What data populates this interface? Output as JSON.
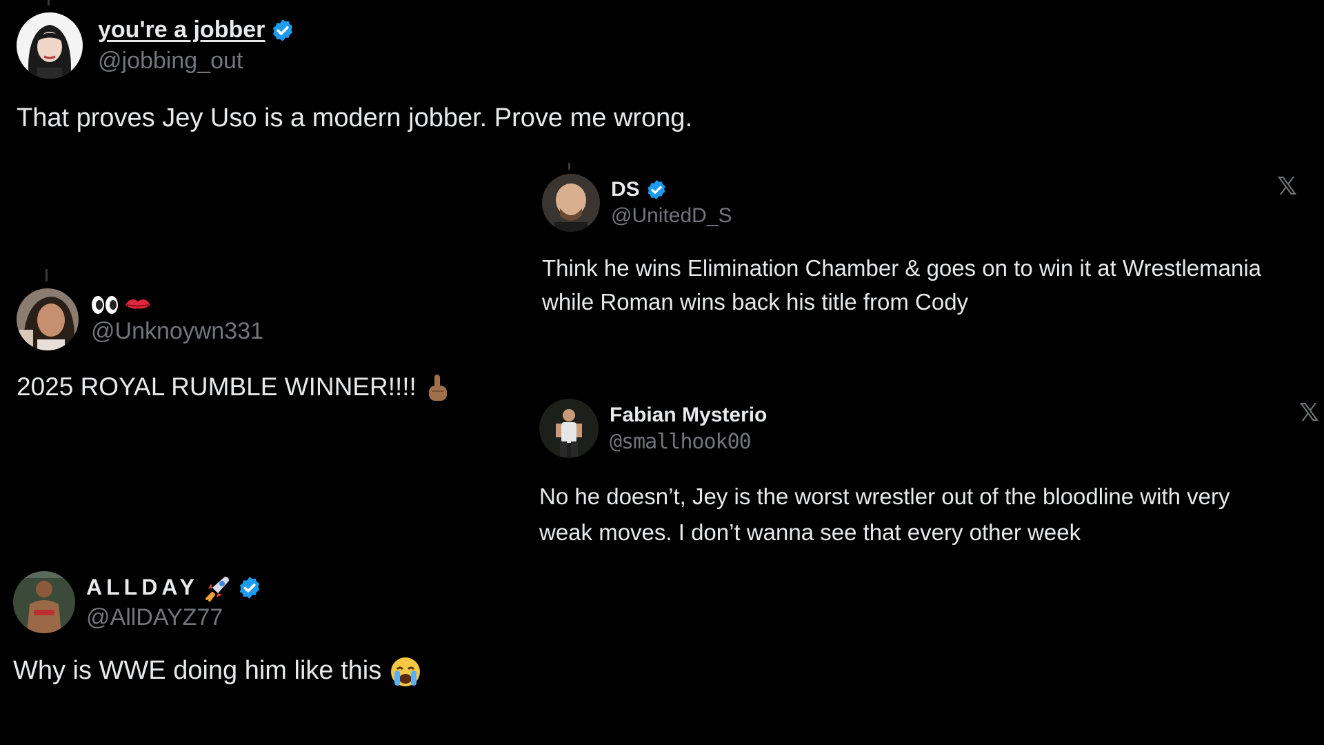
{
  "tweets": [
    {
      "display_name": "you're a jobber",
      "handle": "@jobbing_out",
      "verified": true,
      "text": "That proves Jey Uso is a modern jobber. Prove me wrong."
    },
    {
      "display_name": "DS",
      "handle": "@UnitedD_S",
      "verified": true,
      "text": "Think he wins Elimination Chamber & goes on to win it at Wrestlemania\nwhile Roman wins back his title from Cody"
    },
    {
      "display_name_emojis": [
        "eyes-emoji",
        "kiss-mark-emoji"
      ],
      "handle": "@Unknoywn331",
      "verified": false,
      "text": "2025 ROYAL RUMBLE WINNER!!!!",
      "text_emoji": "index-pointing-up-emoji"
    },
    {
      "display_name": "Fabian Mysterio",
      "handle": "@smallhook00",
      "verified": false,
      "text": "No he doesn’t, Jey is the worst wrestler out of the bloodline with very\nweak moves. I don’t wanna see that every other week"
    },
    {
      "display_name": "ALLDAY",
      "display_name_emoji": "rocket-emoji",
      "handle": "@AllDAYZ77",
      "verified": true,
      "text": "Why is WWE doing him like this",
      "text_emoji": "loudly-crying-face-emoji"
    }
  ],
  "icons": {
    "verified_color": "#1d9bf0",
    "x_logo": "x-logo-icon"
  },
  "colors": {
    "background": "#000000",
    "primary_text": "#e7e9ea",
    "secondary_text": "#71767b"
  }
}
